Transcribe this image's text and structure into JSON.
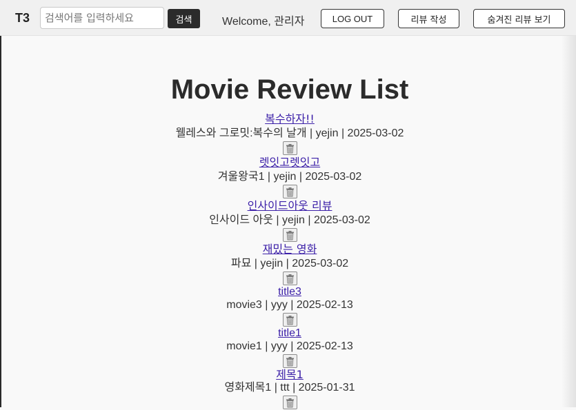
{
  "navbar": {
    "logo": "T3",
    "search_placeholder": "검색어를 입력하세요",
    "search_button": "검색",
    "welcome": "Welcome, 관리자",
    "logout_button": "LOG OUT",
    "write_button": "리뷰 작성",
    "hidden_button": "숨겨진 리뷰 보기"
  },
  "page": {
    "title": "Movie Review List"
  },
  "reviews": [
    {
      "title": "복수하자!!",
      "meta": "웰레스와 그로밋:복수의 날개 | yejin | 2025-03-02"
    },
    {
      "title": "렛잇고렛잇고",
      "meta": "겨울왕국1 | yejin | 2025-03-02"
    },
    {
      "title": "인사이드아웃 리뷰",
      "meta": "인사이드 아웃 | yejin | 2025-03-02"
    },
    {
      "title": "재밌는 영화",
      "meta": "파묘 | yejin | 2025-03-02"
    },
    {
      "title": "title3",
      "meta": "movie3 | yyy | 2025-02-13"
    },
    {
      "title": "title1",
      "meta": "movie1 | yyy | 2025-02-13"
    },
    {
      "title": "제목1",
      "meta": "영화제목1 | ttt | 2025-01-31"
    }
  ],
  "icons": {
    "delete": "trash-icon"
  }
}
